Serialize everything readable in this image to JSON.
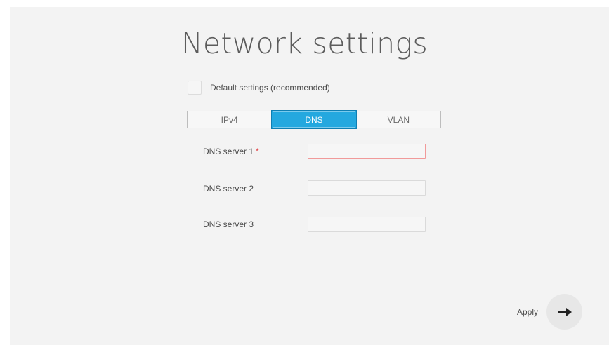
{
  "page": {
    "title": "Network settings"
  },
  "default_settings": {
    "label": "Default settings (recommended)",
    "checked": false
  },
  "tabs": [
    {
      "label": "IPv4",
      "active": false
    },
    {
      "label": "DNS",
      "active": true
    },
    {
      "label": "VLAN",
      "active": false
    }
  ],
  "dns": {
    "server1": {
      "label": "DNS server 1",
      "required_mark": "*",
      "value": ""
    },
    "server2": {
      "label": "DNS server 2",
      "value": ""
    },
    "server3": {
      "label": "DNS server 3",
      "value": ""
    }
  },
  "apply": {
    "label": "Apply",
    "icon": "arrow-right-icon"
  },
  "colors": {
    "panel_bg": "#f3f3f3",
    "active_tab": "#24a8df",
    "required": "#e2464a",
    "error_border": "#f19a9a"
  }
}
